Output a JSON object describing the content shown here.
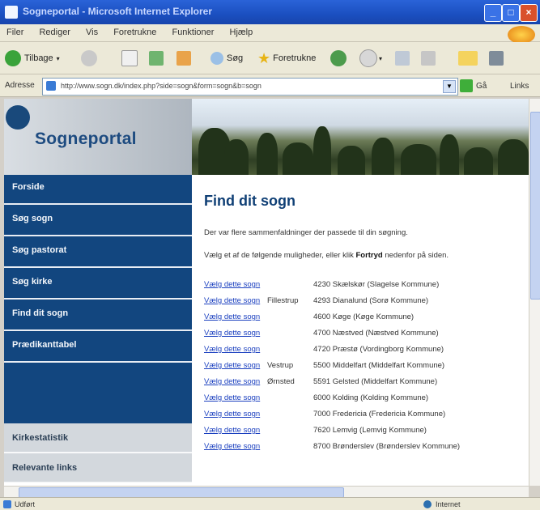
{
  "window": {
    "title": "Sogneportal - Microsoft Internet Explorer"
  },
  "menu": [
    "Filer",
    "Rediger",
    "Vis",
    "Foretrukne",
    "Funktioner",
    "Hjælp"
  ],
  "toolbar": {
    "back_label": "Tilbage",
    "search_label": "Søg",
    "favorites_label": "Foretrukne"
  },
  "address": {
    "label": "Adresse",
    "url": "http://www.sogn.dk/index.php?side=sogn&form=sogn&b=sogn",
    "go_label": "Gå",
    "links_label": "Links"
  },
  "site": {
    "name": "Sogneportal"
  },
  "nav": {
    "items": [
      "Forside",
      "Søg sogn",
      "Søg pastorat",
      "Søg kirke",
      "Find dit sogn",
      "Prædikanttabel"
    ],
    "secondary": [
      "Kirkestatistik",
      "Relevante links"
    ]
  },
  "content": {
    "heading": "Find dit sogn",
    "intro": "Der var flere sammenfaldninger der passede til din søgning.",
    "instruction_pre": "Vælg et af de følgende muligheder, eller klik ",
    "instruction_bold": "Fortryd",
    "instruction_post": " nedenfor på siden.",
    "results": [
      {
        "link": "Vælg dette sogn",
        "by": "",
        "postnr": "4230 Skælskør (Slagelse Kommune)"
      },
      {
        "link": "Vælg dette sogn",
        "by": "Fillestrup",
        "postnr": "4293 Dianalund (Sorø Kommune)"
      },
      {
        "link": "Vælg dette sogn",
        "by": "",
        "postnr": "4600 Køge (Køge Kommune)"
      },
      {
        "link": "Vælg dette sogn",
        "by": "",
        "postnr": "4700 Næstved (Næstved Kommune)"
      },
      {
        "link": "Vælg dette sogn",
        "by": "",
        "postnr": "4720 Præstø (Vordingborg Kommune)"
      },
      {
        "link": "Vælg dette sogn",
        "by": "Vestrup",
        "postnr": "5500 Middelfart (Middelfart Kommune)"
      },
      {
        "link": "Vælg dette sogn",
        "by": "Ørnsted",
        "postnr": "5591 Gelsted (Middelfart Kommune)"
      },
      {
        "link": "Vælg dette sogn",
        "by": "",
        "postnr": "6000 Kolding (Kolding Kommune)"
      },
      {
        "link": "Vælg dette sogn",
        "by": "",
        "postnr": "7000 Fredericia (Fredericia Kommune)"
      },
      {
        "link": "Vælg dette sogn",
        "by": "",
        "postnr": "7620 Lemvig (Lemvig Kommune)"
      },
      {
        "link": "Vælg dette sogn",
        "by": "",
        "postnr": "8700 Brønderslev (Brønderslev Kommune)"
      }
    ]
  },
  "status": {
    "left": "Udført",
    "zone": "Internet"
  },
  "colors": {
    "nav_bg": "#12467f",
    "heading": "#0f3f75",
    "link": "#1a3fbf"
  }
}
